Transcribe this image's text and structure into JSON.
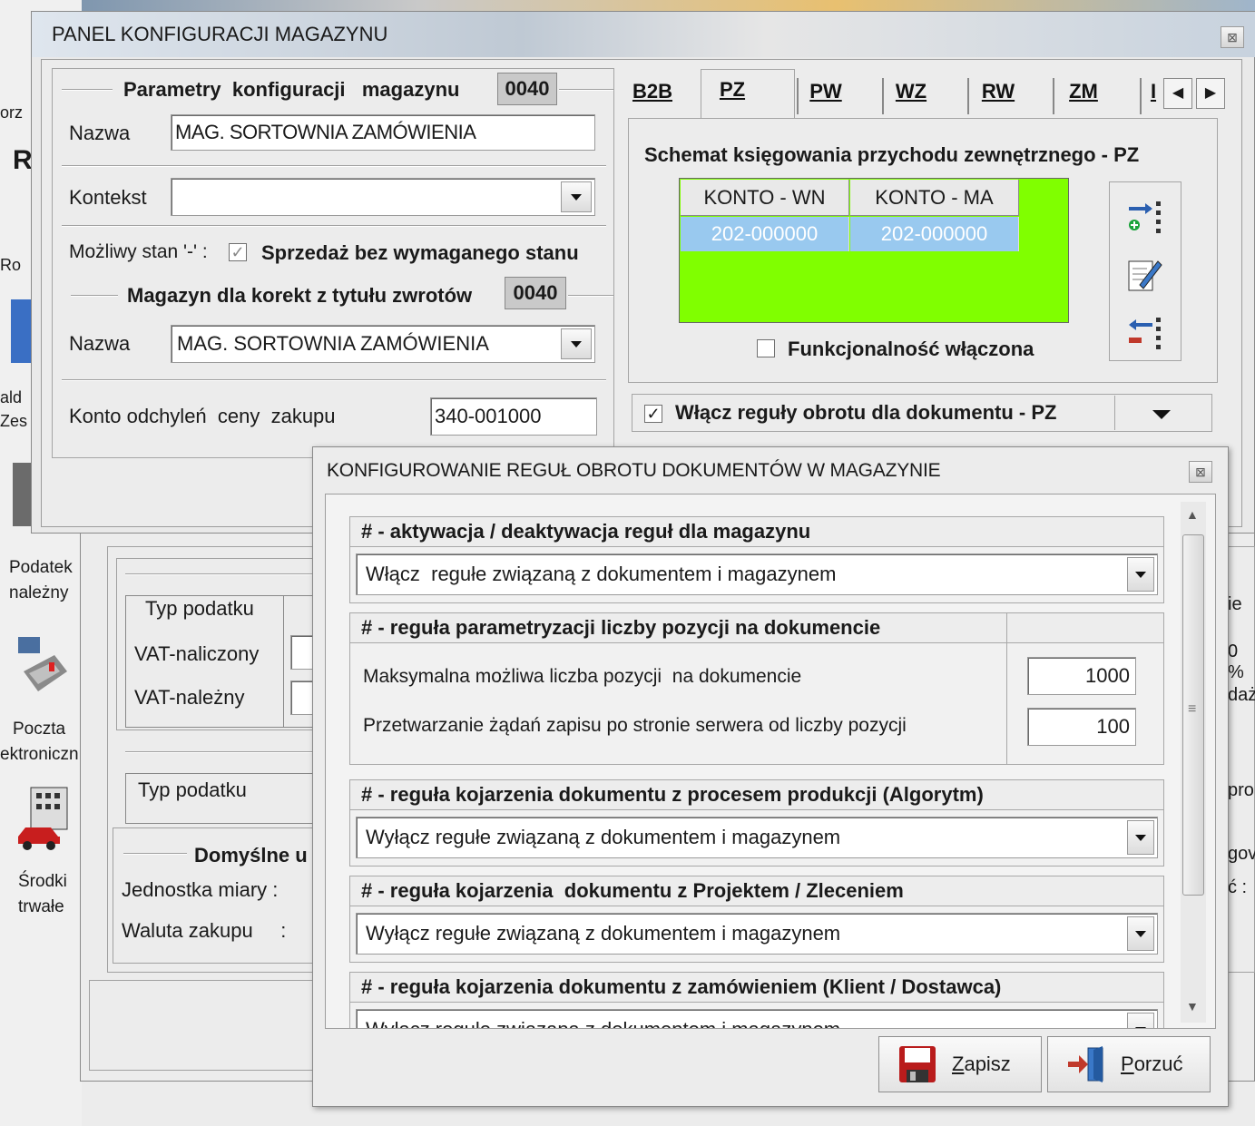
{
  "bg": {
    "left_tags": [
      "orz",
      "Ro",
      "ald",
      "Zes"
    ],
    "podatek": [
      "Podatek",
      "należny"
    ],
    "poczta": [
      "Poczta",
      "ektroniczn"
    ],
    "srodki": [
      "Środki",
      "trwałe"
    ],
    "table1": {
      "header": "Typ podatku",
      "rows": [
        "VAT-naliczony",
        "VAT-należny"
      ]
    },
    "table2": {
      "header": "Typ podatku"
    },
    "defaults": {
      "title": "Domyślne u",
      "unit_label": "Jednostka  miary :",
      "currency_label": "Waluta zakupu     :"
    },
    "right_frag": [
      "ie",
      "0 %",
      "daż",
      "pro",
      "gov",
      "ć :"
    ]
  },
  "main": {
    "title": "PANEL KONFIGURACJI MAGAZYNU",
    "params_title": "Parametry  konfiguracji   magazynu",
    "params_code": "0040",
    "name_label": "Nazwa",
    "name_value": "MAG. SORTOWNIA ZAMÓWIENIA",
    "context_label": "Kontekst",
    "possible_state_label": "Możliwy stan '-' :",
    "sale_label": "Sprzedaż bez wymaganego stanu",
    "correction_title": "Magazyn dla korekt z tytułu zwrotów",
    "correction_code": "0040",
    "corr_name_label": "Nazwa",
    "corr_name_value": "MAG. SORTOWNIA ZAMÓWIENIA",
    "deviation_label": "Konto odchyleń  ceny  zakupu",
    "deviation_value": "340-001000",
    "tabs": [
      "B2B",
      "PZ",
      "PW",
      "WZ",
      "RW",
      "ZM",
      "I"
    ],
    "scheme_title": "Schemat księgowania przychodu zewnętrznego - PZ",
    "grid": {
      "columns": [
        "KONTO - WN",
        "KONTO - MA"
      ],
      "row": [
        "202-000000",
        "202-000000"
      ]
    },
    "functionality_label": "Funkcjonalność włączona",
    "rules_label": "Włącz reguły obrotu dla dokumentu - PZ",
    "colors": {
      "grid_bg": "#80ff00",
      "selected_row": "#99c9ef"
    }
  },
  "rules": {
    "title": "KONFIGUROWANIE REGUŁ OBROTU DOKUMENTÓW W MAGAZYNIE",
    "s1_title": "# - aktywacja / deaktywacja reguł dla magazynu",
    "s1_value": "Włącz  regułe związaną z dokumentem i magazynem",
    "s2_title": "# - reguła parametryzacji  liczby pozycji  na dokumencie",
    "s2_max_label": "Maksymalna możliwa liczba pozycji  na dokumencie",
    "s2_max_value": "1000",
    "s2_server_label": "Przetwarzanie żądań zapisu po stronie serwera od liczby pozycji",
    "s2_server_value": "100",
    "s3_title": "# - reguła kojarzenia dokumentu z procesem  produkcji  (Algorytm)",
    "s3_value": "Wyłącz regułe związaną z dokumentem i magazynem",
    "s4_title": "# - reguła kojarzenia  dokumentu z Projektem / Zleceniem",
    "s4_value": "Wyłącz regułe związaną z dokumentem i magazynem",
    "s5_title": "# - reguła kojarzenia dokumentu z zamówieniem (Klient / Dostawca)",
    "s5_value": "Wyłącz regułe związaną z dokumentem i magazynem",
    "save_label": "Zapisz",
    "cancel_label": "Porzuć"
  }
}
